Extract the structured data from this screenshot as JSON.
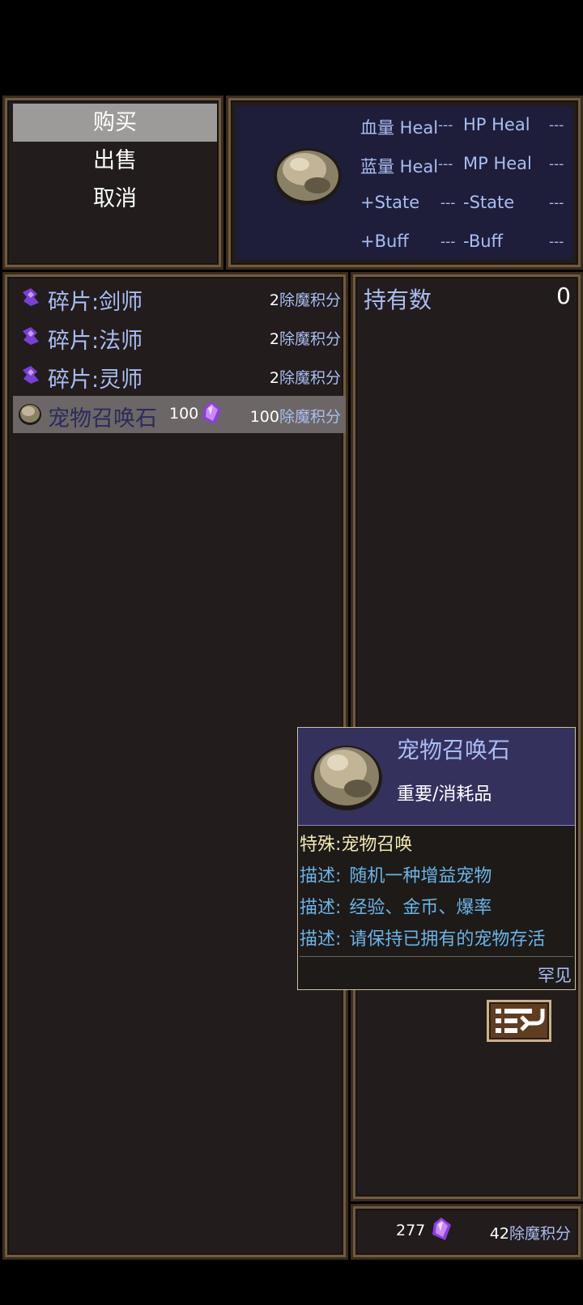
{
  "commands": [
    {
      "label": "购买",
      "selected": true
    },
    {
      "label": "出售",
      "selected": false
    },
    {
      "label": "取消",
      "selected": false
    }
  ],
  "status": {
    "item_icon": "summon-stone-icon",
    "rows": [
      {
        "left_label": "血量 Heal",
        "left_value": "---",
        "right_label": "HP Heal",
        "right_value": "---"
      },
      {
        "left_label": "蓝量 Heal",
        "left_value": "---",
        "right_label": "MP Heal",
        "right_value": "---"
      },
      {
        "left_label": "+State",
        "left_value": "---",
        "right_label": "-State",
        "right_value": "---"
      },
      {
        "left_label": "+Buff",
        "left_value": "---",
        "right_label": "-Buff",
        "right_value": "---"
      }
    ]
  },
  "shop_items": [
    {
      "icon": "purple-shard-icon",
      "name": "碎片:剑师",
      "price": "2",
      "unit": "除魔积分"
    },
    {
      "icon": "purple-shard-icon",
      "name": "碎片:法师",
      "price": "2",
      "unit": "除魔积分"
    },
    {
      "icon": "purple-shard-icon",
      "name": "碎片:灵师",
      "price": "2",
      "unit": "除魔积分"
    },
    {
      "icon": "summon-stone-icon",
      "name": "宠物召唤石",
      "material_qty": "100",
      "material_icon": "purple-crystal-icon",
      "price": "100",
      "unit": "除魔积分",
      "selected": true
    }
  ],
  "number_window": {
    "label": "持有数",
    "value": "0"
  },
  "currency": {
    "material_amount": "277",
    "material_icon": "purple-crystal-icon",
    "points_amount": "42",
    "points_unit": "除魔积分"
  },
  "tooltip": {
    "icon": "summon-stone-icon",
    "name": "宠物召唤石",
    "type": "重要/消耗品",
    "special": "特殊:宠物召唤",
    "descriptions": [
      {
        "key": "描述:",
        "text": "随机一种增益宠物"
      },
      {
        "key": "描述:",
        "text": "经验、金币、爆率"
      },
      {
        "key": "描述:",
        "text": "请保持已拥有的宠物存活"
      }
    ],
    "rarity": "罕见"
  },
  "list_button_icon": "list-toggle-icon",
  "colors": {
    "accent_text": "#a9bdf2",
    "desc_text": "#69b4e7",
    "special_text": "#f2e8b4",
    "window_bg": "#221c1c",
    "selected_bg": "#9d9b99"
  }
}
